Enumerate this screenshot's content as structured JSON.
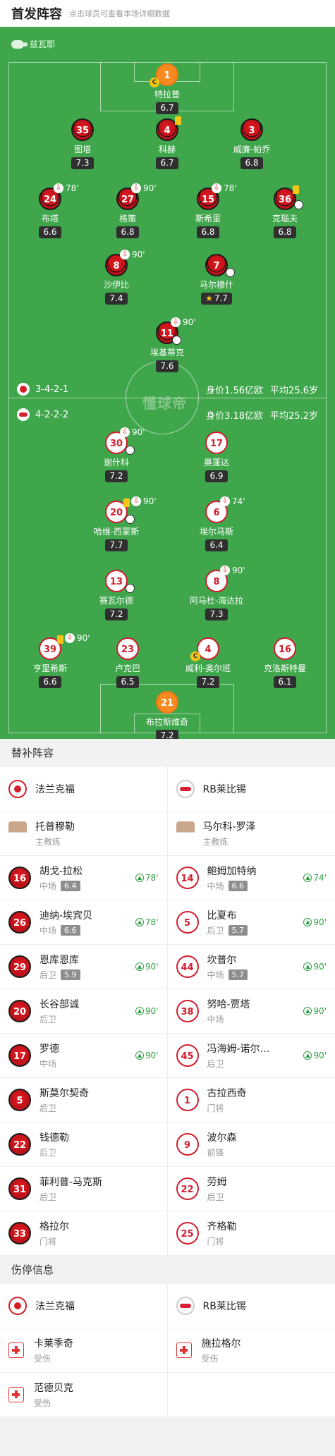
{
  "header": {
    "title": "首发阵容",
    "hint": "点击球员可查看本场详细数据"
  },
  "referee": "兹瓦耶",
  "watermark": "懂球帝",
  "teams": {
    "home": {
      "formation": "3-4-2-1",
      "value": "身价1.56亿欧",
      "age": "平均25.6岁"
    },
    "away": {
      "formation": "4-2-2-2",
      "value": "身价3.18亿欧",
      "age": "平均25.2岁"
    }
  },
  "lineup": {
    "home": [
      {
        "num": "1",
        "name": "特拉普",
        "rating": "6.7",
        "captain": "C"
      },
      {
        "num": "35",
        "name": "图塔",
        "rating": "7.3"
      },
      {
        "num": "4",
        "name": "科赫",
        "rating": "6.7"
      },
      {
        "num": "3",
        "name": "威廉-帕乔",
        "rating": "6.8"
      },
      {
        "num": "24",
        "name": "布塔",
        "rating": "6.6",
        "sub": "78'"
      },
      {
        "num": "27",
        "name": "格策",
        "rating": "6.8",
        "sub": "90'"
      },
      {
        "num": "15",
        "name": "斯希里",
        "rating": "6.8",
        "sub": "78'"
      },
      {
        "num": "36",
        "name": "克瑙夫",
        "rating": "6.8"
      },
      {
        "num": "8",
        "name": "沙伊比",
        "rating": "7.4",
        "sub": "90'"
      },
      {
        "num": "7",
        "name": "马尔穆什",
        "rating": "7.7"
      },
      {
        "num": "11",
        "name": "埃基蒂克",
        "rating": "7.6",
        "sub": "90'"
      }
    ],
    "away": [
      {
        "num": "30",
        "name": "谢什科",
        "rating": "7.2",
        "sub": "90'"
      },
      {
        "num": "17",
        "name": "奥蓬达",
        "rating": "6.9"
      },
      {
        "num": "20",
        "name": "哈维-西蒙斯",
        "rating": "7.7",
        "sub": "90'"
      },
      {
        "num": "6",
        "name": "埃尔马斯",
        "rating": "6.4",
        "sub": "74'"
      },
      {
        "num": "13",
        "name": "赛瓦尔德",
        "rating": "7.2"
      },
      {
        "num": "8",
        "name": "阿马杜-海达拉",
        "rating": "7.3",
        "sub": "90'"
      },
      {
        "num": "39",
        "name": "亨里希斯",
        "rating": "6.6",
        "sub": "90'"
      },
      {
        "num": "23",
        "name": "卢克巴",
        "rating": "6.5"
      },
      {
        "num": "4",
        "name": "威利-奥尔班",
        "rating": "7.2",
        "captain": "C"
      },
      {
        "num": "16",
        "name": "克洛斯特曼",
        "rating": "6.1"
      },
      {
        "num": "21",
        "name": "布拉斯维奇",
        "rating": "7.2"
      }
    ]
  },
  "subs_section": {
    "title": "替补阵容",
    "home_team": "法兰克福",
    "away_team": "RB莱比锡",
    "home_coach": {
      "name": "托普穆勒",
      "role": "主教练"
    },
    "away_coach": {
      "name": "马尔科-罗泽",
      "role": "主教练"
    },
    "rows": [
      [
        {
          "num": "16",
          "name": "胡戈-拉松",
          "pos": "中场",
          "rating": "6.4",
          "in": "78'"
        },
        {
          "num": "14",
          "name": "鲍姆加特纳",
          "pos": "中场",
          "rating": "6.6",
          "in": "74'"
        }
      ],
      [
        {
          "num": "26",
          "name": "迪纳-埃宾贝",
          "pos": "中场",
          "rating": "6.6",
          "in": "78'"
        },
        {
          "num": "5",
          "name": "比夏布",
          "pos": "后卫",
          "rating": "5.7",
          "in": "90'"
        }
      ],
      [
        {
          "num": "29",
          "name": "恩库恩库",
          "pos": "后卫",
          "rating": "5.9",
          "in": "90'"
        },
        {
          "num": "44",
          "name": "坎普尔",
          "pos": "中场",
          "rating": "5.7",
          "in": "90'"
        }
      ],
      [
        {
          "num": "20",
          "name": "长谷部诚",
          "pos": "后卫",
          "rating": "",
          "in": "90'"
        },
        {
          "num": "38",
          "name": "努哈-贾塔",
          "pos": "中场",
          "rating": "",
          "in": "90'"
        }
      ],
      [
        {
          "num": "17",
          "name": "罗德",
          "pos": "中场",
          "rating": "",
          "in": "90'"
        },
        {
          "num": "45",
          "name": "冯海姆-诺尔…",
          "pos": "后卫",
          "rating": "",
          "in": "90'"
        }
      ],
      [
        {
          "num": "5",
          "name": "斯莫尔契奇",
          "pos": "后卫",
          "rating": "",
          "in": ""
        },
        {
          "num": "1",
          "name": "古拉西奇",
          "pos": "门将",
          "rating": "",
          "in": ""
        }
      ],
      [
        {
          "num": "22",
          "name": "钱德勒",
          "pos": "后卫",
          "rating": "",
          "in": ""
        },
        {
          "num": "9",
          "name": "波尔森",
          "pos": "前锋",
          "rating": "",
          "in": ""
        }
      ],
      [
        {
          "num": "31",
          "name": "菲利普-马克斯",
          "pos": "后卫",
          "rating": "",
          "in": ""
        },
        {
          "num": "22",
          "name": "劳姆",
          "pos": "后卫",
          "rating": "",
          "in": ""
        }
      ],
      [
        {
          "num": "33",
          "name": "格拉尔",
          "pos": "门将",
          "rating": "",
          "in": ""
        },
        {
          "num": "25",
          "name": "齐格勒",
          "pos": "门将",
          "rating": "",
          "in": ""
        }
      ]
    ]
  },
  "injury_section": {
    "title": "伤停信息",
    "home_team": "法兰克福",
    "away_team": "RB莱比锡",
    "home": [
      {
        "name": "卡莱季奇",
        "status": "受伤"
      },
      {
        "name": "范德贝克",
        "status": "受伤"
      }
    ],
    "away": [
      {
        "name": "施拉格尔",
        "status": "受伤"
      }
    ]
  }
}
